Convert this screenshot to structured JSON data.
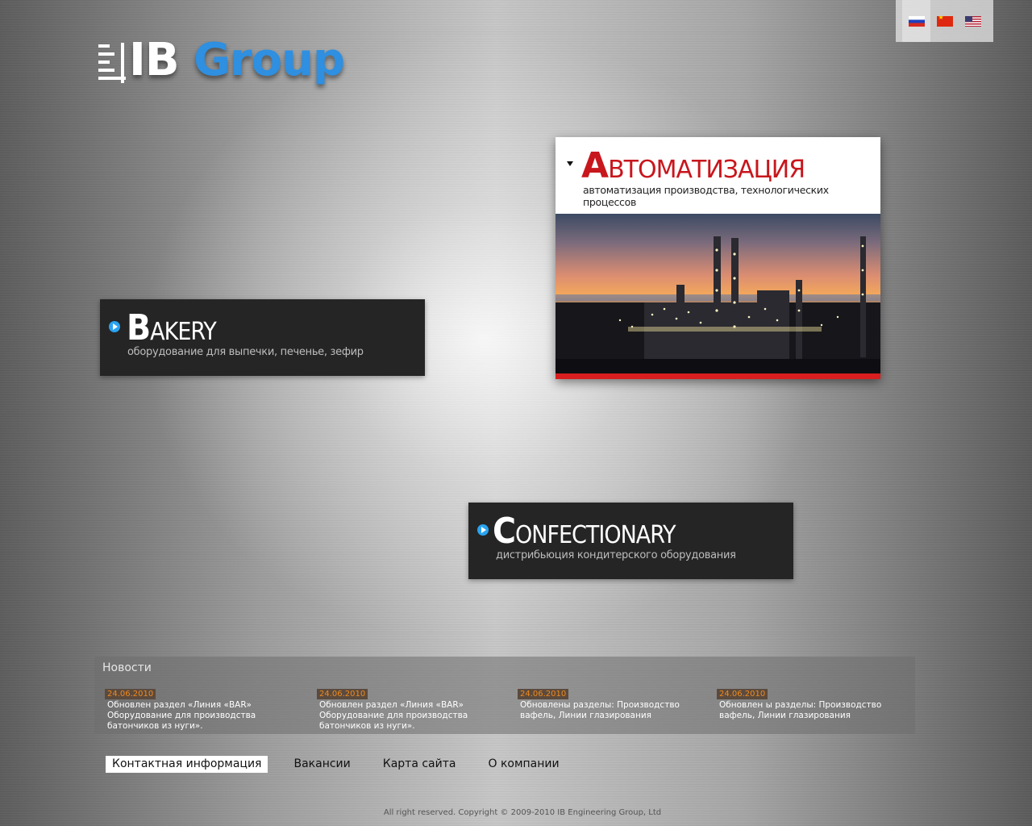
{
  "brand": {
    "name_white": "IB ",
    "name_blue": "Group"
  },
  "languages": [
    {
      "code": "ru",
      "icon": "flag-russia-icon",
      "active": true
    },
    {
      "code": "cn",
      "icon": "flag-china-icon",
      "active": false
    },
    {
      "code": "us",
      "icon": "flag-usa-icon",
      "active": false
    }
  ],
  "sections": {
    "automation": {
      "cap": "А",
      "rest": "ВТОМАТИЗАЦИЯ",
      "subtitle": "автоматизация производства, технологических процессов",
      "accent": "#c8161d"
    },
    "bakery": {
      "cap": "B",
      "rest": "AKERY",
      "subtitle": "оборудование для выпечки, печенье, зефир"
    },
    "confectionary": {
      "cap": "C",
      "rest": "ONFECTIONARY",
      "subtitle": "дистрибьюция кондитерского оборудования"
    }
  },
  "news": {
    "title": "Новости",
    "items": [
      {
        "date": "24.06.2010",
        "text": "Обновлен раздел «Линия «BAR» Оборудование для производства батончиков из нуги»."
      },
      {
        "date": "24.06.2010",
        "text": "Обновлен раздел «Линия «BAR» Оборудование для производства батончиков из нуги»."
      },
      {
        "date": "24.06.2010",
        "text": "Обновлены разделы: Производство вафель, Линии глазирования"
      },
      {
        "date": "24.06.2010",
        "text": "Обновлен ы разделы: Производство вафель, Линии глазирования"
      }
    ]
  },
  "footer_nav": [
    {
      "label": "Контактная информация",
      "active": true
    },
    {
      "label": "Вакансии",
      "active": false
    },
    {
      "label": "Карта сайта",
      "active": false
    },
    {
      "label": "О компании",
      "active": false
    }
  ],
  "copyright": "All right reserved. Copyright © 2009-2010 IB Engineering Group, Ltd"
}
